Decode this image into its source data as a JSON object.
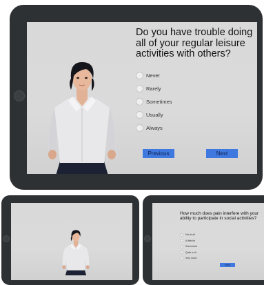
{
  "main_tablet": {
    "question": "Do you have trouble doing all of your regular leisure activities with others?",
    "options": [
      "Never",
      "Rarely",
      "Sometimes",
      "Usually",
      "Always"
    ],
    "previous_label": "Previous",
    "next_label": "Next"
  },
  "right_tablet": {
    "question": "How much does pain interfere with your ability to participate in social activities?",
    "options": [
      "Not at all",
      "A little bit",
      "Somewhat",
      "Quite a bit",
      "Very much"
    ],
    "next_label": "Next"
  },
  "colors": {
    "bezel": "#2e3133",
    "screen": "#d9d9da",
    "button": "#3f78df",
    "shirt": "#e8e8ea",
    "skirt": "#1c2233",
    "hair": "#15161b"
  },
  "icons": [
    "avatar-figure-icon",
    "camera-icon",
    "radio-icon"
  ]
}
